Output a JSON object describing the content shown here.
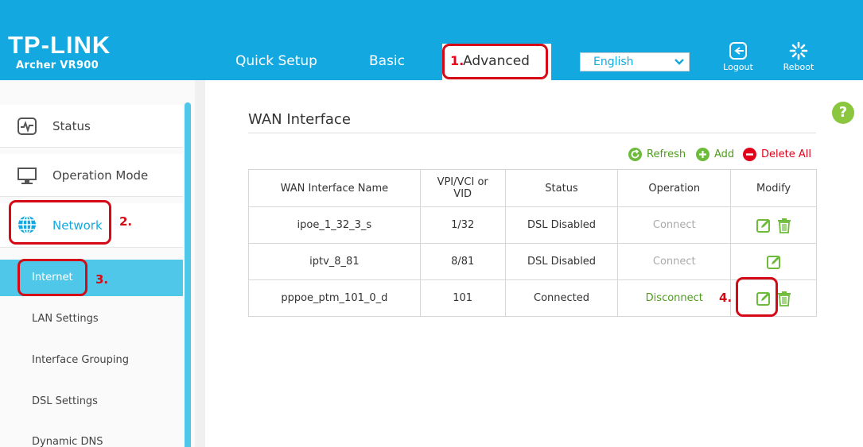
{
  "brand": {
    "logo": "TP-LINK",
    "model": "Archer VR900"
  },
  "nav": {
    "tabs": [
      {
        "label": "Quick Setup"
      },
      {
        "label": "Basic"
      },
      {
        "label": "Advanced",
        "annotation": "1."
      }
    ],
    "language": "English",
    "logout_label": "Logout",
    "reboot_label": "Reboot"
  },
  "sidebar": {
    "main": [
      {
        "label": "Status",
        "icon": "pulse-monitor-icon"
      },
      {
        "label": "Operation Mode",
        "icon": "monitor-icon"
      },
      {
        "label": "Network",
        "icon": "globe-icon",
        "annotation": "2."
      }
    ],
    "sub": [
      {
        "label": "Internet",
        "annotation": "3."
      },
      {
        "label": "LAN Settings"
      },
      {
        "label": "Interface Grouping"
      },
      {
        "label": "DSL Settings"
      },
      {
        "label": "Dynamic DNS"
      }
    ]
  },
  "main": {
    "title": "WAN Interface",
    "help": "?",
    "toolbar": {
      "refresh": "Refresh",
      "add": "Add",
      "delete_all": "Delete All"
    },
    "table": {
      "headers": [
        "WAN Interface Name",
        "VPI/VCI or VID",
        "Status",
        "Operation",
        "Modify"
      ],
      "rows": [
        {
          "name": "ipoe_1_32_3_s",
          "vpi": "1/32",
          "status": "DSL Disabled",
          "operation": "Connect"
        },
        {
          "name": "iptv_8_81",
          "vpi": "8/81",
          "status": "DSL Disabled",
          "operation": "Connect"
        },
        {
          "name": "pppoe_ptm_101_0_d",
          "vpi": "101",
          "status": "Connected",
          "operation": "Disconnect",
          "annotation": "4."
        }
      ]
    }
  },
  "colors": {
    "header": "#13a9e0",
    "active": "#4ec7e8",
    "green": "#4d9d1a",
    "red": "#e3001b",
    "annotation": "#d40a16"
  }
}
